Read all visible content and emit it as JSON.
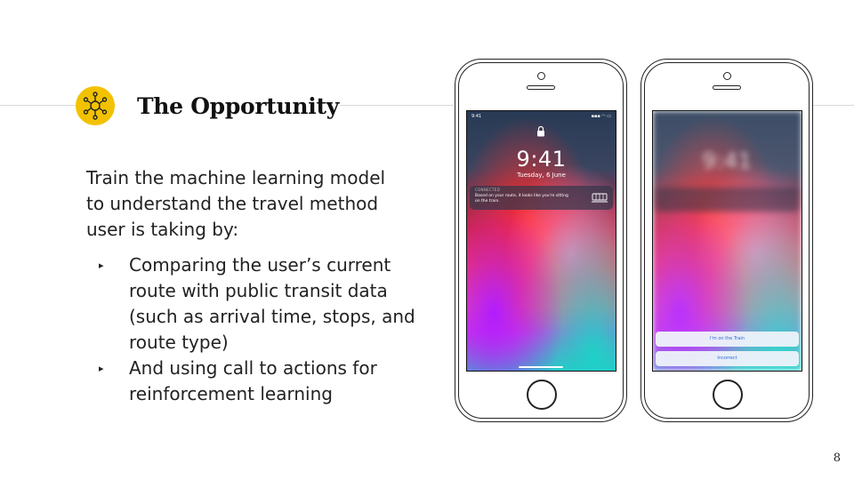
{
  "slide": {
    "title": "The Opportunity",
    "icon": "network-hub-icon",
    "accent_color": "#f2c200",
    "intro": "Train the machine learning model to understand the travel method user is taking by:",
    "bullets": [
      "Comparing the user’s current route with public transit data (such as arrival time, stops, and route type)",
      "And using call to actions for reinforcement learning"
    ],
    "bullet_marker": "▸",
    "page_number": "8"
  },
  "phone1": {
    "status_time": "9:41",
    "time": "9:41",
    "date": "Tuesday, 6 June",
    "notification_app": "CONNECTED",
    "notification_text": "Based on your route, it looks like you're sitting on the train."
  },
  "phone2": {
    "action1": "I'm on the Train",
    "action2": "Incorrect"
  }
}
